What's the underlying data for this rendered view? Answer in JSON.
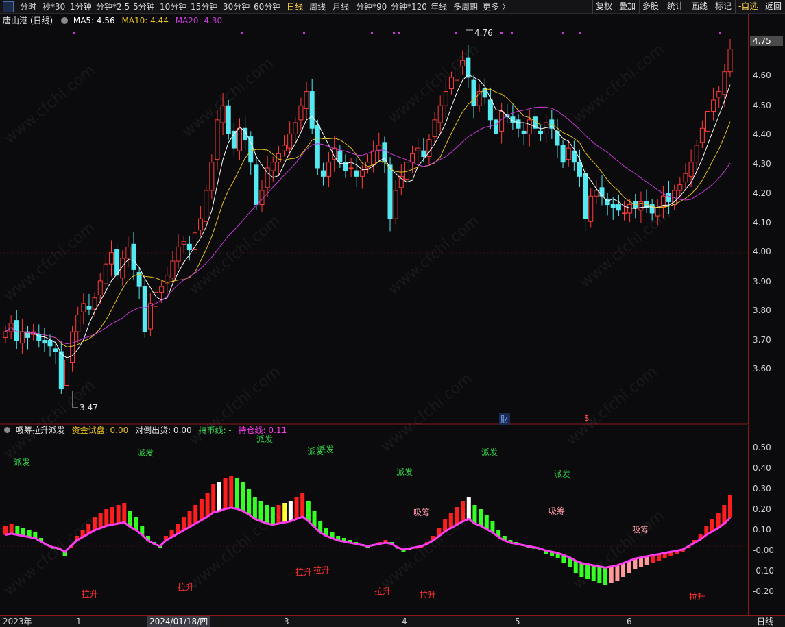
{
  "toolbar": {
    "left": [
      "分时",
      "秒*30",
      "1分钟",
      "分钟*2.5",
      "5分钟",
      "10分钟",
      "15分钟",
      "30分钟",
      "60分钟",
      "日线",
      "周线",
      "月线",
      "分钟*90",
      "分钟*120",
      "年线",
      "多周期",
      "更多 〉"
    ],
    "active_index": 9,
    "right": [
      "复权",
      "叠加",
      "多股",
      "统计",
      "画线",
      "标记",
      "-自选",
      "返回"
    ]
  },
  "main_header": {
    "name": "唐山港 (日线)",
    "ma5": "MA5: 4.56",
    "ma10": "MA10: 4.44",
    "ma20": "MA20: 4.30"
  },
  "indicator_header": {
    "name": "吸筹拉升派发",
    "fund": "资金试盘: 0.00",
    "dump": "对倒出货: 0.00",
    "hold": "持币线: -",
    "position": "持仓线: 0.11"
  },
  "price_axis": {
    "current": "4.75",
    "ticks": [
      "4.60",
      "4.50",
      "4.40",
      "4.30",
      "4.20",
      "4.10",
      "4.00",
      "3.90",
      "3.80",
      "3.70",
      "3.60"
    ]
  },
  "ind_axis": {
    "ticks": [
      "0.50",
      "0.40",
      "0.30",
      "0.20",
      "0.10",
      "-0.00",
      "-0.10",
      "-0.20"
    ]
  },
  "x_axis": {
    "labels": [
      "2023年",
      "1",
      "3",
      "4",
      "5",
      "6"
    ],
    "cursor": "2024/01/18/四",
    "period": "日线"
  },
  "annotations": {
    "high": "4.76",
    "low": "3.47",
    "finance": "财",
    "dividend": "$"
  },
  "signals": [
    {
      "text": "派发",
      "kind": "g"
    },
    {
      "text": "派发",
      "kind": "g"
    },
    {
      "text": "派发",
      "kind": "g"
    },
    {
      "text": "派发",
      "kind": "g"
    },
    {
      "text": "派发",
      "kind": "g"
    },
    {
      "text": "派发",
      "kind": "g"
    },
    {
      "text": "派发",
      "kind": "g"
    },
    {
      "text": "派发",
      "kind": "g"
    },
    {
      "text": "拉升",
      "kind": "r"
    },
    {
      "text": "拉升",
      "kind": "r"
    },
    {
      "text": "拉升",
      "kind": "r"
    },
    {
      "text": "拉升",
      "kind": "r"
    },
    {
      "text": "拉升",
      "kind": "r"
    },
    {
      "text": "拉升",
      "kind": "r"
    },
    {
      "text": "拉升",
      "kind": "r"
    },
    {
      "text": "吸筹",
      "kind": "p"
    },
    {
      "text": "吸筹",
      "kind": "p"
    },
    {
      "text": "吸筹",
      "kind": "p"
    }
  ],
  "watermark": "www.cfchi.com",
  "colors": {
    "up": "#ff3b3b",
    "down": "#54e8f0",
    "ma5": "#ffffff",
    "ma10": "#e8c020",
    "ma20": "#c83ad8",
    "pos_line": "#ff3af0",
    "bar_red": "#ff1e1e",
    "bar_green": "#33ff22",
    "bar_pink": "#ff9a9a",
    "bar_yellow": "#ffff33",
    "bar_white": "#ffffff"
  },
  "chart_data": {
    "type": "candlestick",
    "ylim": [
      3.47,
      4.76
    ],
    "closes": [
      3.7,
      3.73,
      3.67,
      3.7,
      3.68,
      3.7,
      3.67,
      3.66,
      3.65,
      3.63,
      3.5,
      3.6,
      3.7,
      3.76,
      3.8,
      3.78,
      3.82,
      3.88,
      3.94,
      3.98,
      3.9,
      3.96,
      4.0,
      3.92,
      3.86,
      3.7,
      3.8,
      3.84,
      3.86,
      3.9,
      3.95,
      4.0,
      4.02,
      3.99,
      4.05,
      4.1,
      4.2,
      4.3,
      4.45,
      4.5,
      4.4,
      4.35,
      4.42,
      4.38,
      4.3,
      4.15,
      4.2,
      4.28,
      4.3,
      4.33,
      4.36,
      4.4,
      4.44,
      4.5,
      4.55,
      4.42,
      4.28,
      4.25,
      4.3,
      4.35,
      4.3,
      4.27,
      4.28,
      4.25,
      4.27,
      4.3,
      4.34,
      4.36,
      4.3,
      4.1,
      4.2,
      4.25,
      4.3,
      4.33,
      4.35,
      4.32,
      4.38,
      4.45,
      4.5,
      4.55,
      4.6,
      4.64,
      4.66,
      4.6,
      4.5,
      4.55,
      4.53,
      4.45,
      4.4,
      4.48,
      4.46,
      4.44,
      4.42,
      4.4,
      4.45,
      4.42,
      4.4,
      4.44,
      4.42,
      4.36,
      4.3,
      4.35,
      4.3,
      4.25,
      4.1,
      4.18,
      4.2,
      4.18,
      4.15,
      4.14,
      4.13,
      4.12,
      4.15,
      4.14,
      4.16,
      4.14,
      4.12,
      4.14,
      4.18,
      4.16,
      4.2,
      4.22,
      4.26,
      4.3,
      4.36,
      4.42,
      4.48,
      4.52,
      4.55,
      4.62,
      4.7
    ],
    "ind_values": [
      0.1,
      0.11,
      0.1,
      0.09,
      0.08,
      0.07,
      0.04,
      0.01,
      -0.01,
      -0.02,
      -0.05,
      0.0,
      0.05,
      0.08,
      0.11,
      0.14,
      0.16,
      0.18,
      0.19,
      0.2,
      0.21,
      0.17,
      0.14,
      0.1,
      0.05,
      0.02,
      0.0,
      0.05,
      0.08,
      0.11,
      0.14,
      0.17,
      0.2,
      0.23,
      0.26,
      0.3,
      0.31,
      0.33,
      0.34,
      0.33,
      0.31,
      0.28,
      0.24,
      0.22,
      0.2,
      0.19,
      0.2,
      0.21,
      0.22,
      0.24,
      0.26,
      0.22,
      0.17,
      0.12,
      0.09,
      0.07,
      0.05,
      0.04,
      0.03,
      0.02,
      0.01,
      0.0,
      0.01,
      0.02,
      0.03,
      0.02,
      -0.01,
      -0.03,
      -0.02,
      -0.01,
      0.0,
      0.02,
      0.05,
      0.09,
      0.13,
      0.16,
      0.19,
      0.22,
      0.24,
      0.2,
      0.18,
      0.15,
      0.12,
      0.08,
      0.05,
      0.03,
      0.02,
      0.01,
      0.0,
      -0.01,
      -0.02,
      -0.04,
      -0.05,
      -0.06,
      -0.08,
      -0.1,
      -0.13,
      -0.15,
      -0.16,
      -0.17,
      -0.18,
      -0.19,
      -0.18,
      -0.17,
      -0.15,
      -0.13,
      -0.11,
      -0.1,
      -0.09,
      -0.08,
      -0.07,
      -0.06,
      -0.05,
      -0.04,
      -0.03,
      0.0,
      0.03,
      0.06,
      0.1,
      0.13,
      0.16,
      0.2,
      0.25
    ]
  }
}
